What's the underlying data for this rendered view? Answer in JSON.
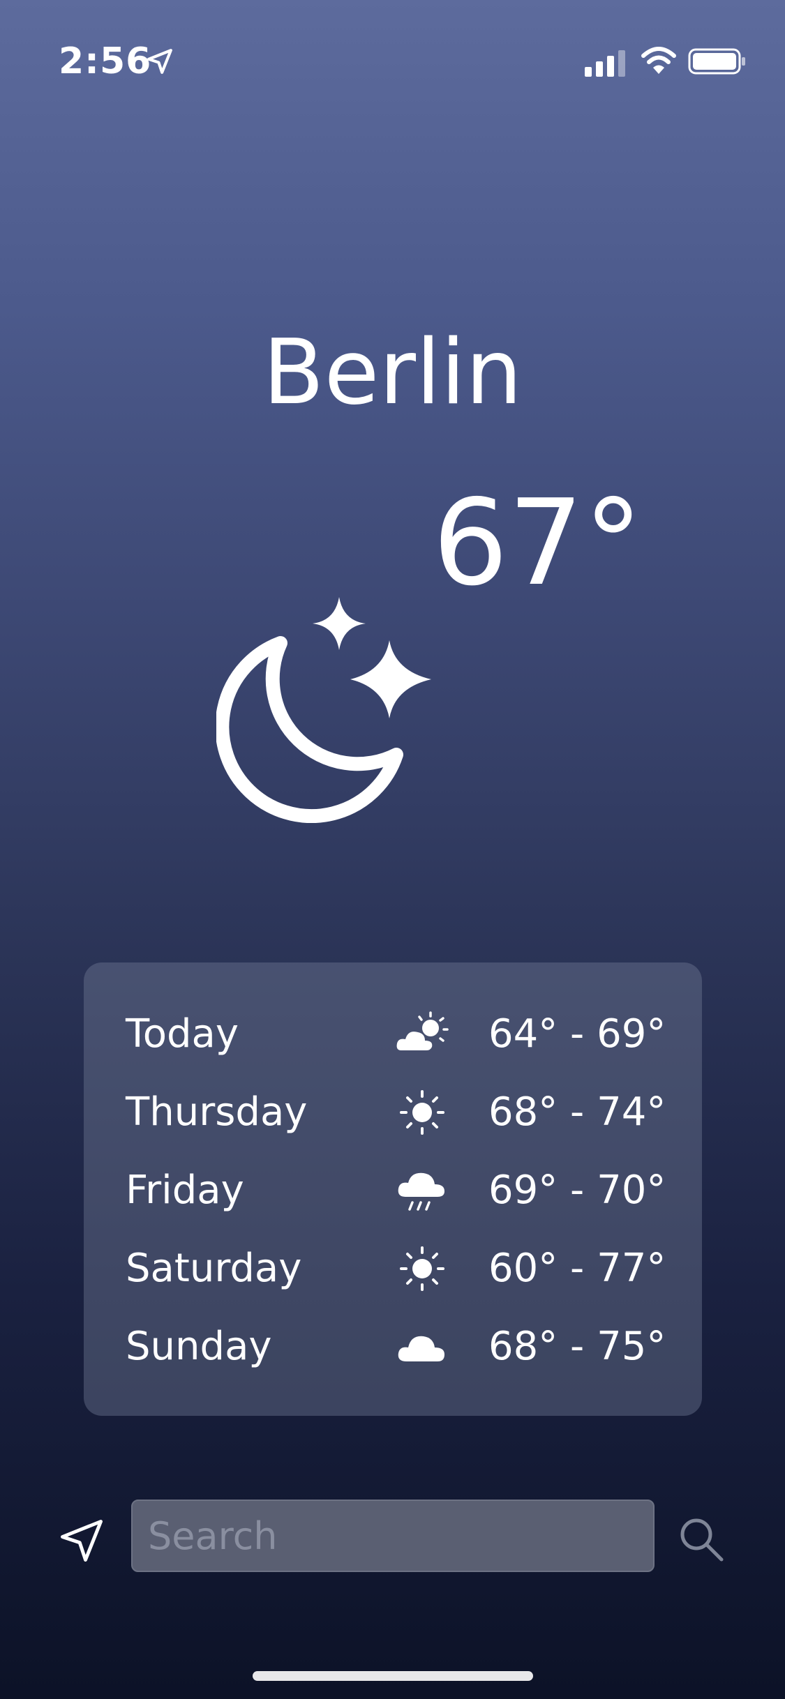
{
  "status_bar": {
    "time": "2:56"
  },
  "city": "Berlin",
  "current_temp": "67°",
  "current_condition_icon": "moon-stars-icon",
  "forecast": [
    {
      "day": "Today",
      "icon": "partly-cloudy-icon",
      "range": "64° - 69°"
    },
    {
      "day": "Thursday",
      "icon": "sun-icon",
      "range": "68° - 74°"
    },
    {
      "day": "Friday",
      "icon": "rain-icon",
      "range": "69° - 70°"
    },
    {
      "day": "Saturday",
      "icon": "sun-icon",
      "range": "60° - 77°"
    },
    {
      "day": "Sunday",
      "icon": "cloud-icon",
      "range": "68° - 75°"
    }
  ],
  "search": {
    "placeholder": "Search",
    "value": ""
  }
}
